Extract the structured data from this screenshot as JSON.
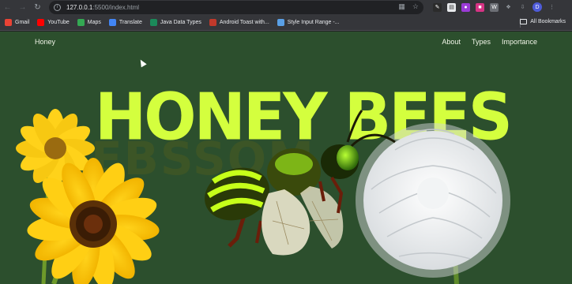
{
  "browser": {
    "url_host": "127.0.0.1",
    "url_path": ":5500/index.html",
    "profile_initial": "D",
    "bookmarks": [
      {
        "label": "Gmail",
        "color": "#ea4335"
      },
      {
        "label": "YouTube",
        "color": "#ff0000"
      },
      {
        "label": "Maps",
        "color": "#34a853"
      },
      {
        "label": "Translate",
        "color": "#4285f4"
      },
      {
        "label": "Java Data Types",
        "color": "#1b8a5a"
      },
      {
        "label": "Android Toast with...",
        "color": "#c0392b"
      },
      {
        "label": "Style Input Range -...",
        "color": "#5aa0e6"
      }
    ],
    "all_bookmarks": "All Bookmarks"
  },
  "site": {
    "brand": "Honey",
    "nav": [
      "About",
      "Types",
      "Importance"
    ],
    "headline": "HONEY BEES",
    "ghost_text": "EBSSOM",
    "background": "#2c4f2d",
    "accent": "#d4ff3e"
  }
}
